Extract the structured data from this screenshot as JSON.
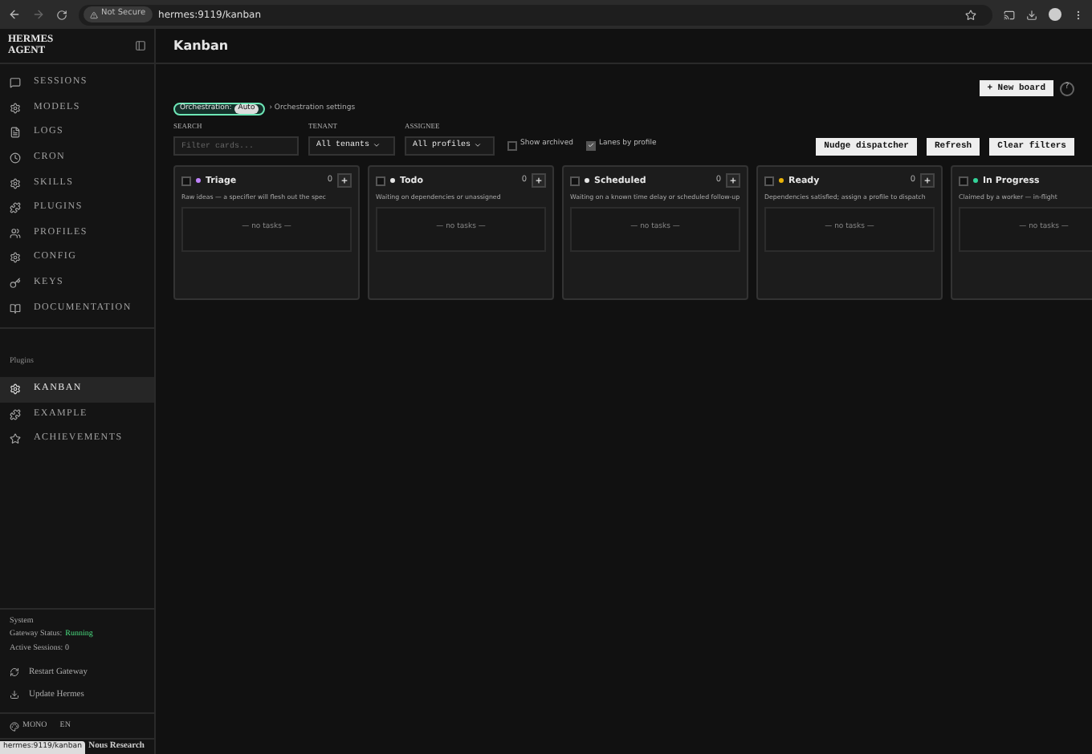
{
  "browser": {
    "security": "Not Secure",
    "url": "hermes:9119/kanban"
  },
  "sidebar": {
    "logo": [
      "HERMES",
      "AGENT"
    ],
    "items": [
      {
        "label": "SESSIONS",
        "selected": false
      },
      {
        "label": "MODELS",
        "selected": false
      },
      {
        "label": "LOGS",
        "selected": false
      },
      {
        "label": "CRON",
        "selected": false
      },
      {
        "label": "SKILLS",
        "selected": false
      },
      {
        "label": "PLUGINS",
        "selected": false
      },
      {
        "label": "PROFILES",
        "selected": false
      },
      {
        "label": "CONFIG",
        "selected": false
      },
      {
        "label": "KEYS",
        "selected": false
      },
      {
        "label": "DOCUMENTATION",
        "selected": false
      }
    ],
    "plugins_heading": "Plugins",
    "plugin_items": [
      {
        "label": "KANBAN",
        "selected": true
      },
      {
        "label": "EXAMPLE",
        "selected": false
      },
      {
        "label": "ACHIEVEMENTS",
        "selected": false
      }
    ],
    "system": {
      "heading": "System",
      "gateway_label": "Gateway Status:",
      "gateway_status": "Running",
      "sessions": "Active Sessions: 0"
    },
    "actions": [
      "Restart Gateway",
      "Update Hermes"
    ],
    "theme": "MONO",
    "language": "EN"
  },
  "header": {
    "title": "Kanban"
  },
  "new_board": "+ New board",
  "help": "?",
  "orchestration": {
    "label": "Orchestration:",
    "value": "Auto",
    "link": "› Orchestration settings"
  },
  "filters": {
    "search_label": "SEARCH",
    "search_placeholder": "Filter cards...",
    "tenant_label": "TENANT",
    "tenant_value": "All tenants",
    "assignee_label": "ASSIGNEE",
    "assignee_value": "All profiles"
  },
  "toggles": [
    {
      "label": "Show archived",
      "checked": false
    },
    {
      "label": "Lanes by profile",
      "checked": true
    }
  ],
  "buttons": [
    "Nudge dispatcher",
    "Refresh",
    "Clear filters"
  ],
  "columns": [
    {
      "name": "Triage",
      "checked": false,
      "color": "#c084fc",
      "count": "0",
      "description": "Raw ideas — a specifier will flesh out the spec",
      "empty": "— no tasks —"
    },
    {
      "name": "Todo",
      "checked": false,
      "color": "#e5e5e5",
      "count": "0",
      "description": "Waiting on dependencies or unassigned",
      "empty": "— no tasks —"
    },
    {
      "name": "Scheduled",
      "checked": false,
      "color": "#e5e5e5",
      "count": "0",
      "description": "Waiting on a known time delay or scheduled follow-up",
      "empty": "— no tasks —"
    },
    {
      "name": "Ready",
      "checked": false,
      "color": "#eab308",
      "count": "0",
      "description": "Dependencies satisfied; assign a profile to dispatch",
      "empty": "— no tasks —"
    },
    {
      "name": "In Progress",
      "checked": false,
      "color": "#34d399",
      "description": "Claimed by a worker — in-flight",
      "empty": "— no tasks —"
    }
  ],
  "status_link": "hermes:9119/kanban",
  "footer_brand": "Nous Research"
}
